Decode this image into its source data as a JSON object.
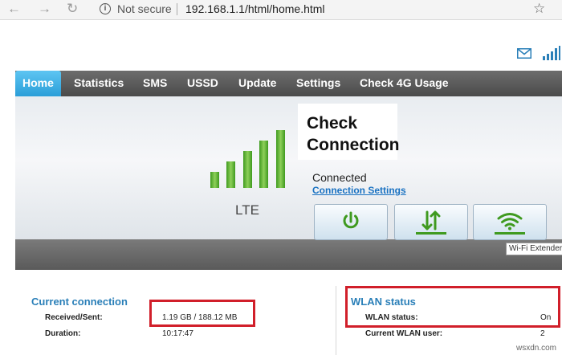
{
  "browser": {
    "back": "←",
    "forward": "→",
    "reload": "↻",
    "info": "i",
    "security_label": "Not secure",
    "url": "192.168.1.1/html/home.html",
    "bookmark": "☆"
  },
  "nav": {
    "tabs": [
      {
        "label": "Home"
      },
      {
        "label": "Statistics"
      },
      {
        "label": "SMS"
      },
      {
        "label": "USSD"
      },
      {
        "label": "Update"
      },
      {
        "label": "Settings"
      },
      {
        "label": "Check 4G Usage"
      }
    ],
    "active": "Home"
  },
  "banner": {
    "callout": "Check Connection",
    "network_type": "LTE",
    "status": "Connected",
    "settings_link": "Connection Settings",
    "tooltip": "Wi-Fi Extender",
    "signal_level": 5,
    "signal_max": 5
  },
  "current_connection": {
    "title": "Current connection",
    "rows": [
      {
        "label": "Received/Sent:",
        "value": "1.19 GB /  188.12 MB"
      },
      {
        "label": "Duration:",
        "value": "10:17:47"
      }
    ]
  },
  "wlan": {
    "title": "WLAN status",
    "rows": [
      {
        "label": "WLAN status:",
        "value": "On"
      },
      {
        "label": "Current WLAN user:",
        "value": "2"
      }
    ]
  },
  "watermark": "wsxdn.com",
  "colors": {
    "accent": "#2a9ed8",
    "signal_green": "#4fa82a",
    "highlight_red": "#d11f2a",
    "link": "#1a72c2"
  },
  "icons": [
    "back-arrow-icon",
    "forward-arrow-icon",
    "reload-icon",
    "info-icon",
    "star-icon",
    "mail-icon",
    "signal-icon",
    "power-icon",
    "transfer-arrows-icon",
    "wifi-icon"
  ]
}
